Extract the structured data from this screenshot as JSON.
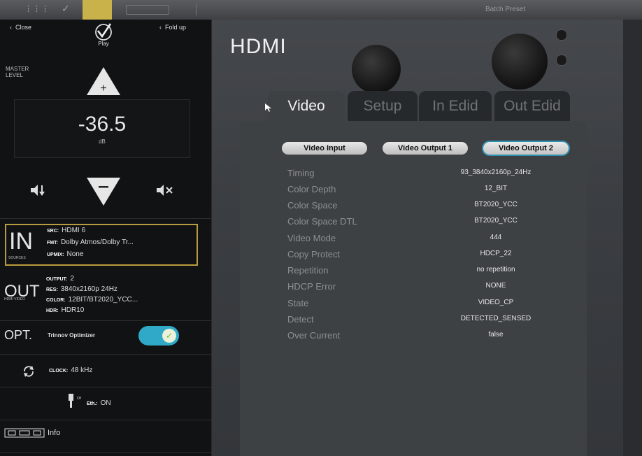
{
  "topbar": {
    "preset_label": "Batch Preset"
  },
  "left": {
    "close_label": "Close",
    "foldup_label": "Fold up",
    "logo_text": "Play",
    "master_label": "MASTER LEVEL",
    "volume": {
      "value": "-36.5",
      "unit": "dB"
    },
    "input": {
      "big": "IN",
      "sub": "SOURCES",
      "src_key": "SRC:",
      "src_val": "HDMI 6",
      "fmt_key": "FMT:",
      "fmt_val": "Dolby Atmos/Dolby Tr...",
      "upmix_key": "UPMIX:",
      "upmix_val": "None"
    },
    "output": {
      "big": "OUT",
      "sub": "HDMI VIDEO",
      "output_key": "OUTPUT:",
      "output_val": "2",
      "res_key": "RES:",
      "res_val": "3840x2160p 24Hz",
      "color_key": "COLOR:",
      "color_val": "12BIT/BT2020_YCC...",
      "hdr_key": "HDR:",
      "hdr_val": "HDR10"
    },
    "opt": {
      "big": "OPT.",
      "label": "Trinnov Optimizer",
      "toggle_on": true
    },
    "clock": {
      "key": "CLOCK:",
      "val": "48 kHz"
    },
    "eth": {
      "key": "Eth.:",
      "val": "ON"
    },
    "info_label": "Info"
  },
  "main": {
    "title": "HDMI",
    "tabs": [
      {
        "label": "Video",
        "active": true
      },
      {
        "label": "Setup",
        "active": false
      },
      {
        "label": "In Edid",
        "active": false
      },
      {
        "label": "Out Edid",
        "active": false
      }
    ],
    "buttons": [
      "Video Input",
      "Video Output 1",
      "Video Output 2"
    ],
    "selected_button": "Video Output 2",
    "rows": [
      {
        "label": "Timing",
        "value": "93_3840x2160p_24Hz"
      },
      {
        "label": "Color Depth",
        "value": "12_BIT"
      },
      {
        "label": "Color Space",
        "value": "BT2020_YCC"
      },
      {
        "label": "Color Space DTL",
        "value": "BT2020_YCC"
      },
      {
        "label": "Video Mode",
        "value": "444"
      },
      {
        "label": "Copy Protect",
        "value": "HDCP_22"
      },
      {
        "label": "Repetition",
        "value": "no repetition"
      },
      {
        "label": "HDCP Error",
        "value": "NONE"
      },
      {
        "label": "State",
        "value": "VIDEO_CP"
      },
      {
        "label": "Detect",
        "value": "DETECTED_SENSED"
      },
      {
        "label": "Over Current",
        "value": "false"
      }
    ]
  },
  "colors": {
    "accent": "#2fa9c7",
    "highlight_border": "#b89b3c"
  }
}
